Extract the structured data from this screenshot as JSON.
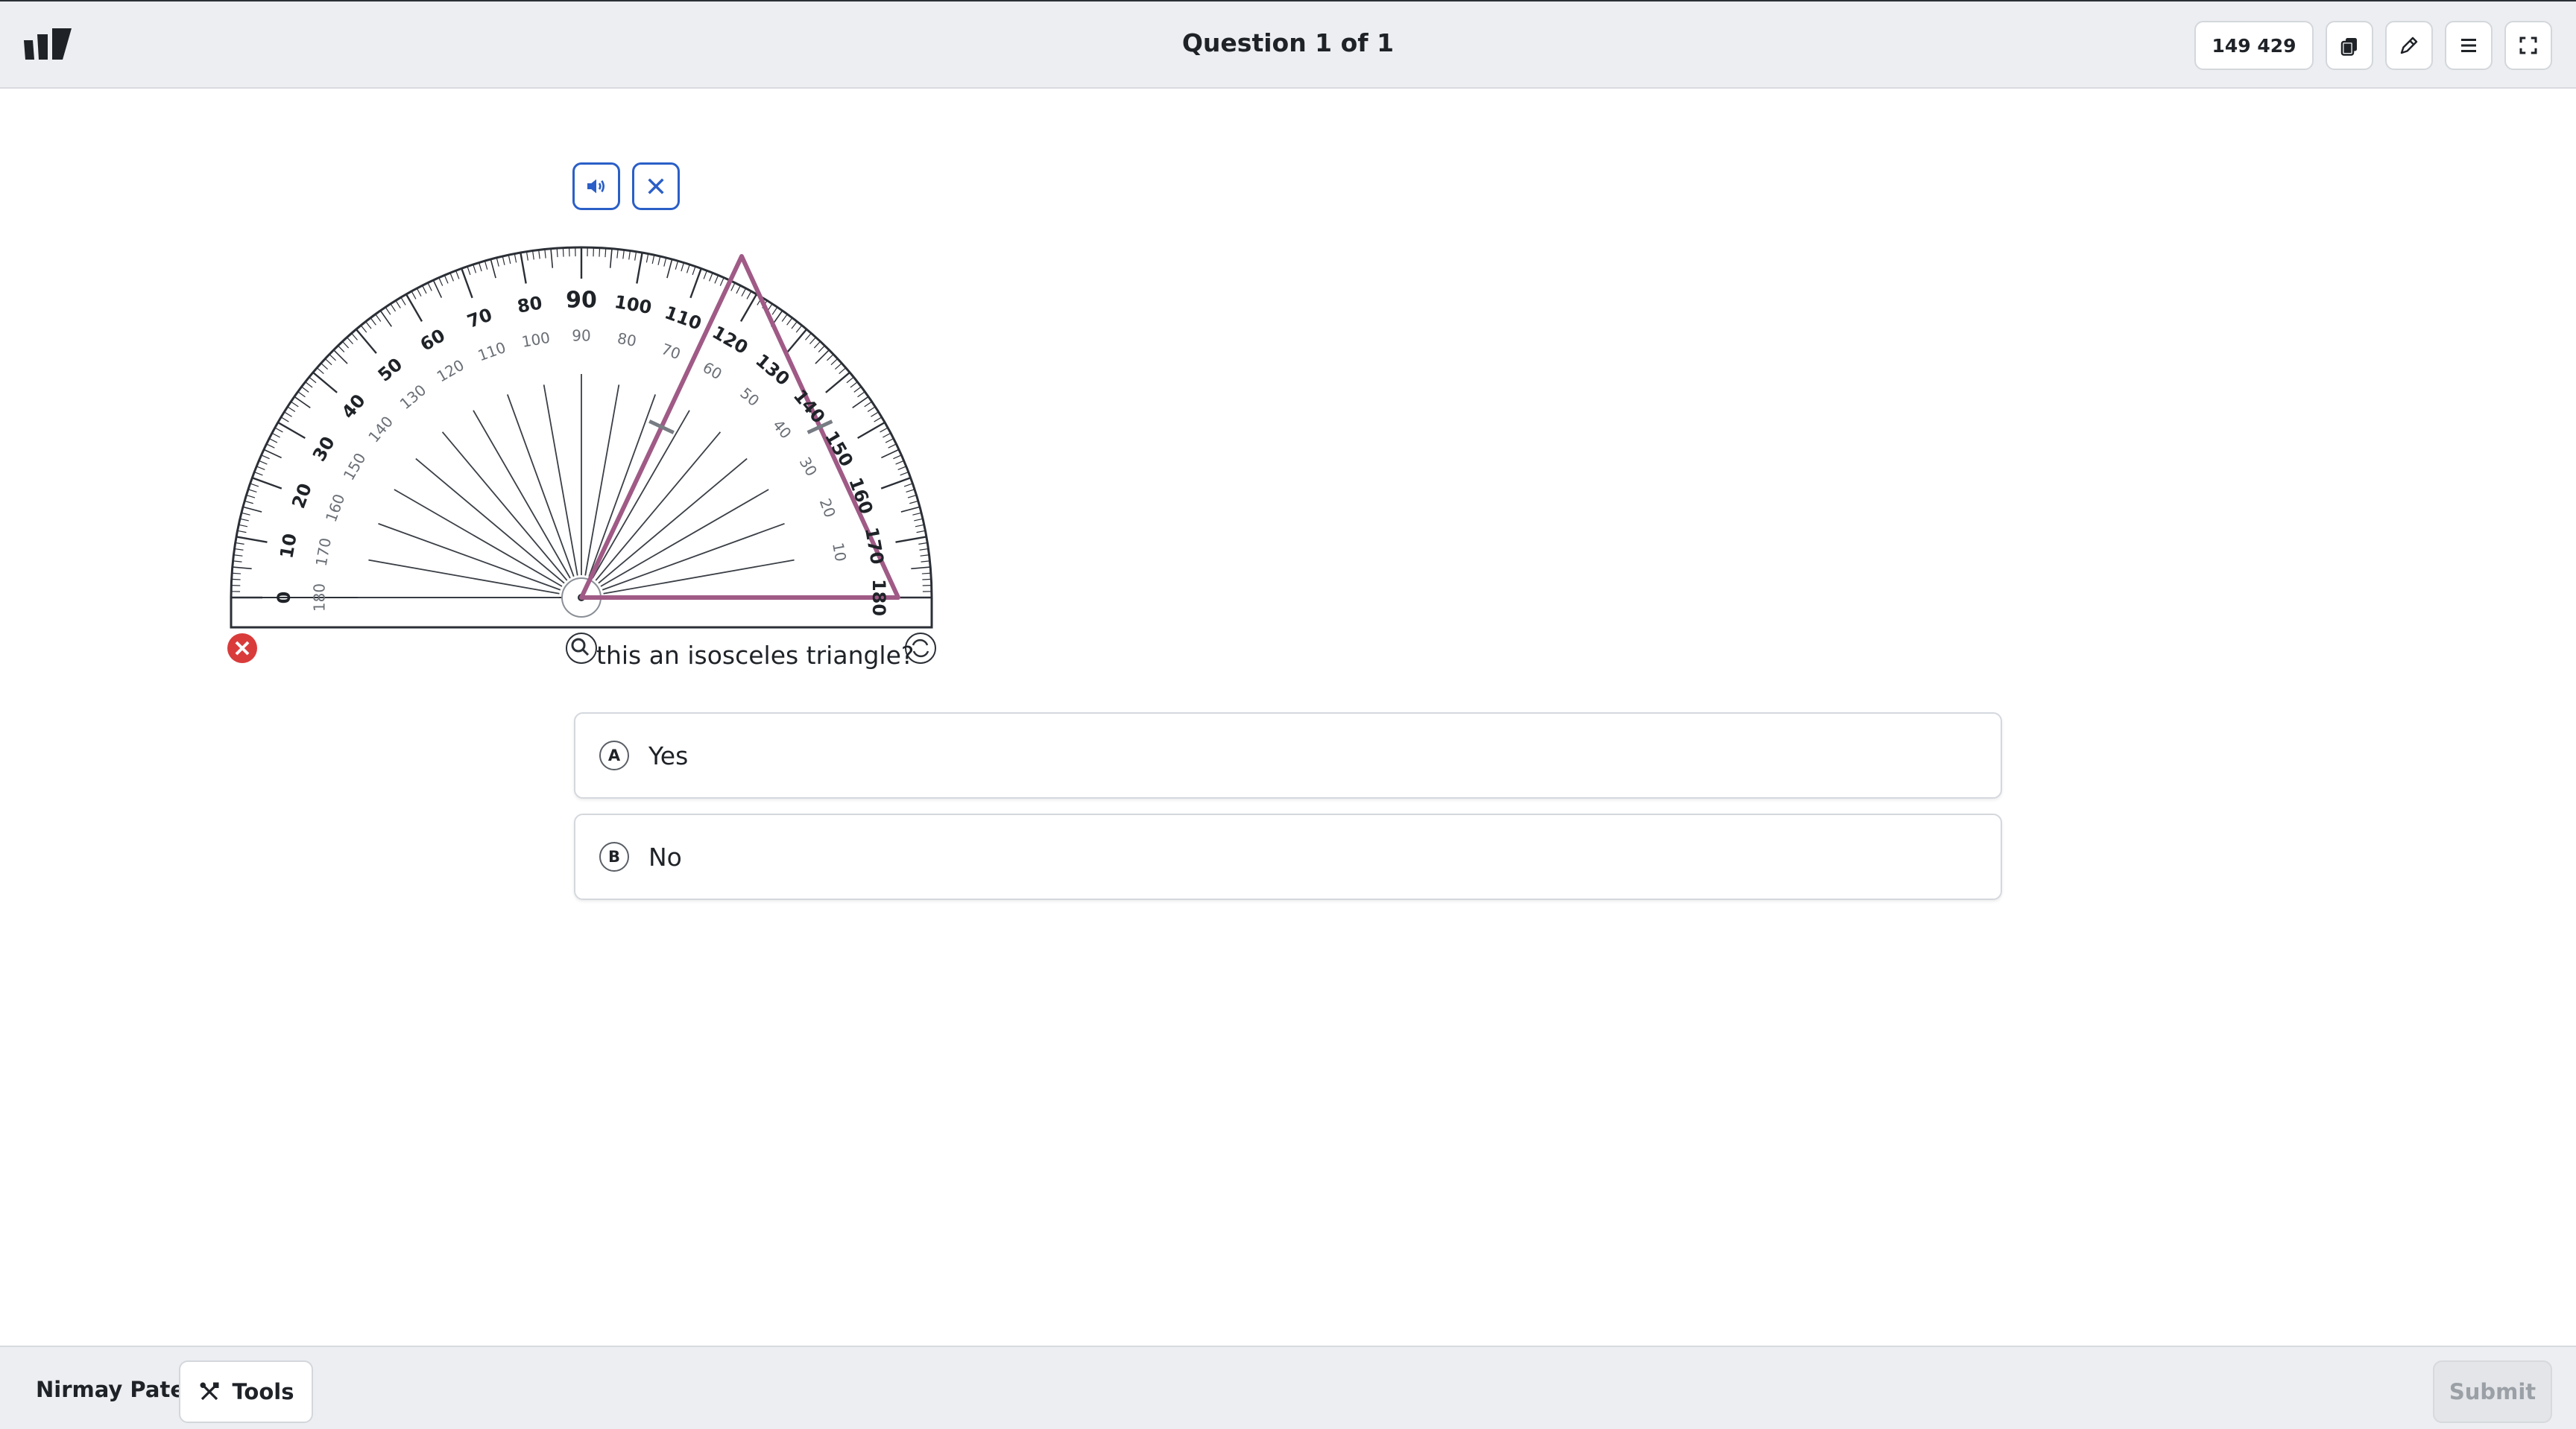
{
  "header": {
    "title": "Question 1 of 1",
    "id_badge": "149 429",
    "buttons": [
      "copy-icon",
      "pencil-icon",
      "menu-icon",
      "fullscreen-icon"
    ]
  },
  "question": {
    "text": "this an isosceles triangle?",
    "options": [
      {
        "letter": "A",
        "label": "Yes"
      },
      {
        "letter": "B",
        "label": "No"
      }
    ]
  },
  "protractor": {
    "outer_scale": [
      "0",
      "10",
      "20",
      "30",
      "40",
      "50",
      "60",
      "70",
      "80",
      "90",
      "100",
      "110",
      "120",
      "130",
      "140",
      "150",
      "160",
      "170",
      "180"
    ],
    "inner_scale": [
      "180",
      "170",
      "160",
      "150",
      "140",
      "130",
      "120",
      "110",
      "100",
      "90",
      "80",
      "70",
      "60",
      "50",
      "40",
      "30",
      "20",
      "10"
    ],
    "triangle_color": "#a05a86"
  },
  "footer": {
    "student_name": "Nirmay Patel",
    "tools_label": "Tools",
    "submit_label": "Submit"
  },
  "colors": {
    "accent": "#2b5fc7",
    "close_red": "#d93b3b"
  }
}
